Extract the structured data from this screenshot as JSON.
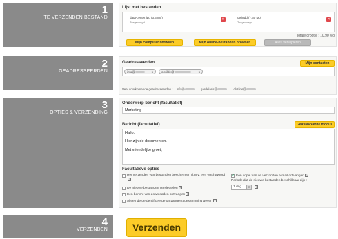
{
  "step1": {
    "number": "1",
    "label": "TE VERZENDEN BESTAND"
  },
  "step2": {
    "number": "2",
    "label": "GEADRESSEERDEN"
  },
  "step3": {
    "number": "3",
    "label": "OPTIES & VERZENDING"
  },
  "step4": {
    "number": "4",
    "label": "VERZENDEN"
  },
  "files": {
    "title": "Lijst met bestanden",
    "items": [
      {
        "name": "data-center.jpg",
        "size": "(3.3 Mo)",
        "status": "Toegevoegd"
      },
      {
        "name": "09.indd",
        "size": "(7.60 Mo)",
        "status": "Toegevoegd"
      }
    ],
    "total": "Totale grootte : 10.90 Mo",
    "btn_browse": "Mijn computer browsen",
    "btn_online": "Mijn online-bestanden browsen",
    "btn_delete": "Alles verwijderen"
  },
  "recipients": {
    "title": "Geadresseerden",
    "btn_contacts": "Mijn contacten",
    "tags": [
      {
        "prefix": "info@"
      },
      {
        "prefix": "clotilde@"
      }
    ],
    "previous_label": "Veel voorkomende geadresseerden :",
    "previous": [
      "info@",
      "gardelaris@",
      "clotilde@"
    ]
  },
  "options": {
    "subject_label": "Onderwerp bericht (facultatief)",
    "subject_value": "Marketing",
    "message_label": "Bericht (facultatief)",
    "btn_advanced": "Geavanceerde modus",
    "message_lines": [
      "Hallo,",
      "Hier zijn de documenten.",
      "Met vriendelijke groet,"
    ],
    "optional_title": "Facultatieve opties",
    "left_options": [
      {
        "label": "Het verzenden van bestanden beschermen d.m.v. een wachtwoord",
        "checked": false
      },
      {
        "label": "De nieuwe bestanden versleutelen",
        "checked": false
      },
      {
        "label": "Een bericht van downloaden ontvangen",
        "checked": false
      },
      {
        "label": "Alleen de geïdentificeerde ontvangers toestemming geven",
        "checked": false
      }
    ],
    "right_option": {
      "label": "Een kopie van de verzonden e-mail ontvangen",
      "checked": true
    },
    "period_label": "Periode dat de nieuwe bestanden beschikbaar zijn :",
    "period_value": "1 dag",
    "help_glyph": "?"
  },
  "send": {
    "label": "Verzenden"
  }
}
